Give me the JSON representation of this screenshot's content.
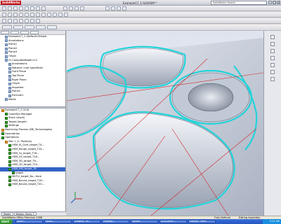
{
  "app": {
    "logo": "SolidWorks",
    "title": "Example17_1.SLDASM *",
    "search_placeholder": "SolidWorks Search"
  },
  "feature_tree": {
    "items": [
      {
        "label": "Example17_1 (Default<Displa"
      },
      {
        "label": "Annotations"
      },
      {
        "label": "Plane1"
      },
      {
        "label": "Plane2"
      },
      {
        "label": "Plane3"
      },
      {
        "label": "Origin"
      },
      {
        "label": "(f) CompleteModel<1>"
      },
      {
        "label": "Annotations"
      },
      {
        "label": "Material <not specified>"
      },
      {
        "label": "Front Plane"
      },
      {
        "label": "Top Plane"
      },
      {
        "label": "Right Plane"
      },
      {
        "label": "Origin"
      },
      {
        "label": "Imported"
      },
      {
        "label": "Plane1"
      },
      {
        "label": "Extrude1"
      },
      {
        "label": "Mates"
      }
    ]
  },
  "cam_tree": {
    "items": [
      {
        "label": "Example17_1 (Cut)",
        "kind": "orange",
        "sel": false
      },
      {
        "label": "CoordSys Manager",
        "kind": "green",
        "sel": false
      },
      {
        "label": "Stock (stock)",
        "kind": "green",
        "sel": false
      },
      {
        "label": "Target (target)",
        "kind": "green",
        "sel": false
      },
      {
        "label": "Settings",
        "kind": "green",
        "sel": false
      },
      {
        "label": "Machining Process (MK_Technologies)",
        "kind": "orange",
        "sel": false
      },
      {
        "label": "Geometries",
        "kind": "green",
        "sel": false
      },
      {
        "label": "Operations",
        "kind": "green",
        "sel": false
      },
      {
        "label": "Mac 1 (1- Position)",
        "kind": "orange",
        "sel": false
      },
      {
        "label": "HSM_IS_Cont_target_T4...",
        "kind": "green",
        "sel": false
      },
      {
        "label": "HSM_Rough_target_T24...",
        "kind": "green",
        "sel": false
      },
      {
        "label": "HSM_2z_target_T16...",
        "kind": "green",
        "sel": false
      },
      {
        "label": "HSM_2Z_target_T16...",
        "kind": "green",
        "sel": false
      },
      {
        "label": "HSM_3D_target_T6...",
        "kind": "green",
        "sel": false
      },
      {
        "label": "HSM_1D_target_T10...",
        "kind": "green",
        "sel": false
      },
      {
        "label": "HSM_HM_target_T6",
        "kind": "green",
        "sel": true
      },
      {
        "label": "target",
        "kind": "green",
        "sel": false
      },
      {
        "label": "MUTLI_target_Bo...Hore",
        "kind": "green",
        "sel": false
      },
      {
        "label": "HSM_Bound_target_T16...",
        "kind": "green",
        "sel": false
      },
      {
        "label": "HSM_Bound_target_T20...",
        "kind": "green",
        "sel": false
      }
    ]
  },
  "panel_tabs": {
    "model": "Model",
    "motion": "Motion Study 1"
  },
  "status": {
    "app": "SolidWorks Office Premium 2008",
    "state": "Fully Defined",
    "mode": "Editing Assembly"
  },
  "taskbar": {
    "start": "start",
    "tasks": [
      "Solidr...",
      "SolidC...",
      "Drawing - Mi...",
      "Pkygaqu...",
      "Solidfo...",
      "SOLIDWOR...",
      "untitled - Paint"
    ],
    "clock": "9:24 AM"
  },
  "colors": {
    "toolpath": "#22d3d9",
    "selected": "#3163c5",
    "part_surface": "#cfd5e0",
    "cut_line": "#d02a2a"
  }
}
